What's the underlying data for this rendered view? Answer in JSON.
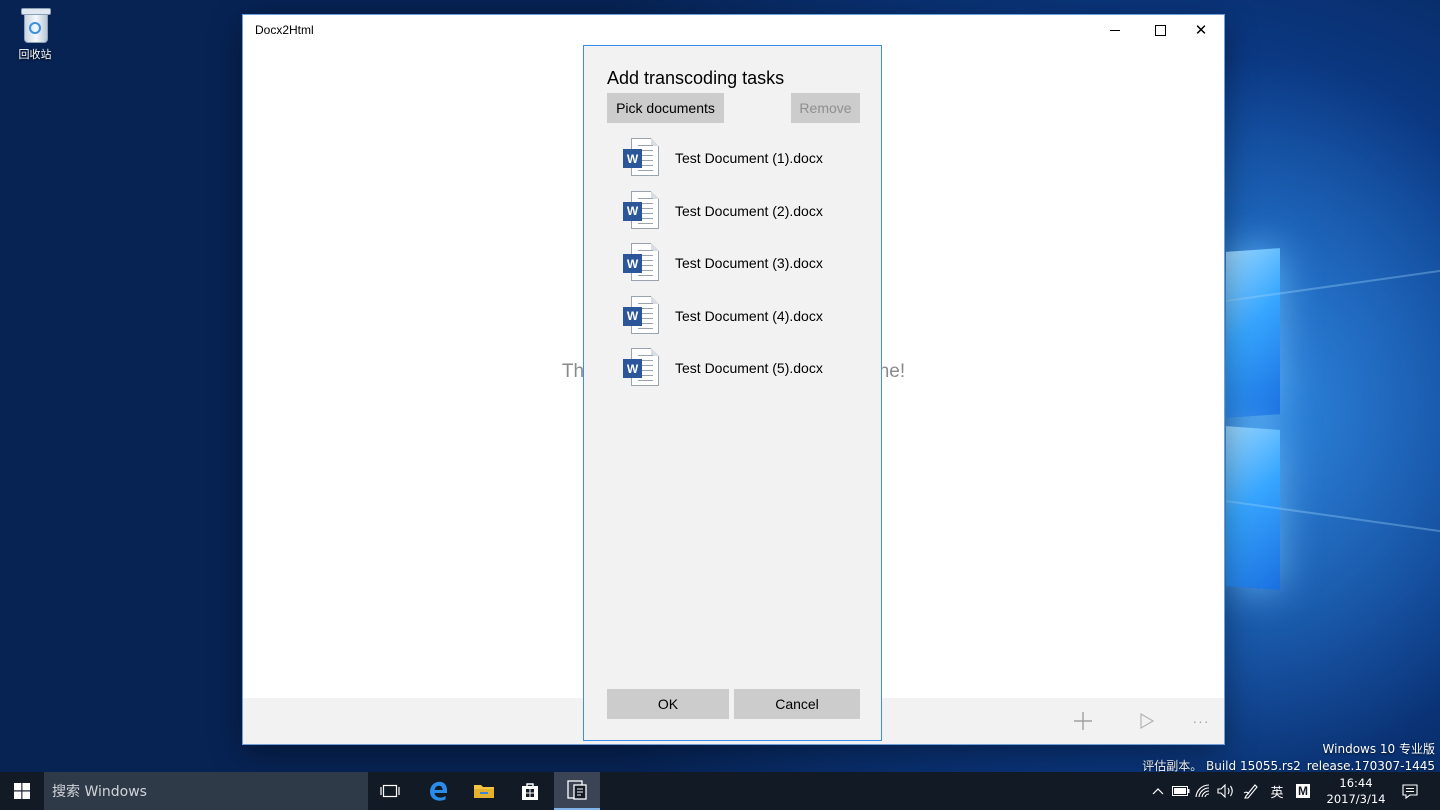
{
  "desktop": {
    "recycle_bin_label": "回收站",
    "watermark_line1": "Windows 10 专业版",
    "watermark_line2": "评估副本。 Build 15055.rs2_release.170307-1445"
  },
  "window": {
    "title": "Docx2Html",
    "empty_message": "There are no tasks here. Add a new one!",
    "appbar": {
      "add_icon": "plus-icon",
      "start_icon": "play-icon",
      "more_label": "···"
    }
  },
  "dialog": {
    "title": "Add transcoding tasks",
    "pick_label": "Pick documents",
    "remove_label": "Remove",
    "files": [
      {
        "name": "Test Document (1).docx",
        "icon": "W"
      },
      {
        "name": "Test Document (2).docx",
        "icon": "W"
      },
      {
        "name": "Test Document (3).docx",
        "icon": "W"
      },
      {
        "name": "Test Document (4).docx",
        "icon": "W"
      },
      {
        "name": "Test Document (5).docx",
        "icon": "W"
      }
    ],
    "ok_label": "OK",
    "cancel_label": "Cancel"
  },
  "taskbar": {
    "search_placeholder": "搜索 Windows",
    "ime_label": "英",
    "ime_mode": "M",
    "time": "16:44",
    "date": "2017/3/14"
  },
  "colors": {
    "accent": "#3d8ee6",
    "word_blue": "#2b579a",
    "taskbar": "#121a26"
  }
}
